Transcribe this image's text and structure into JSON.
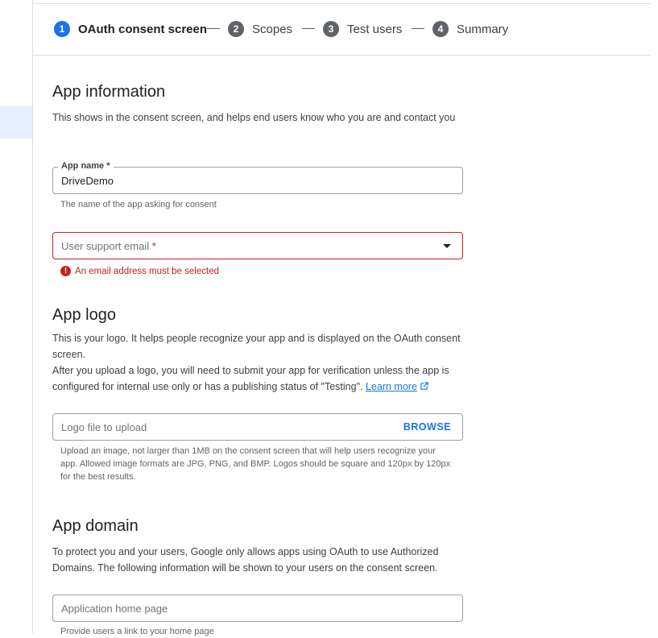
{
  "stepper": {
    "steps": [
      {
        "num": "1",
        "label": "OAuth consent screen"
      },
      {
        "num": "2",
        "label": "Scopes"
      },
      {
        "num": "3",
        "label": "Test users"
      },
      {
        "num": "4",
        "label": "Summary"
      }
    ]
  },
  "app_information": {
    "title": "App information",
    "description": "This shows in the consent screen, and helps end users know who you are and contact you",
    "app_name": {
      "label": "App name *",
      "value": "DriveDemo",
      "hint": "The name of the app asking for consent"
    },
    "support_email": {
      "placeholder": "User support email",
      "required_mark": "*",
      "error": "An email address must be selected"
    }
  },
  "app_logo": {
    "title": "App logo",
    "description_1": "This is your logo. It helps people recognize your app and is displayed on the OAuth consent screen.",
    "description_2": "After you upload a logo, you will need to submit your app for verification unless the app is configured for internal use only or has a publishing status of \"Testing\".",
    "learn_more": "Learn more",
    "upload": {
      "placeholder": "Logo file to upload",
      "browse_label": "BROWSE",
      "hint": "Upload an image, not larger than 1MB on the consent screen that will help users recognize your app. Allowed image formats are JPG, PNG, and BMP. Logos should be square and 120px by 120px for the best results."
    }
  },
  "app_domain": {
    "title": "App domain",
    "description": "To protect you and your users, Google only allows apps using OAuth to use Authorized Domains. The following information will be shown to your users on the consent screen.",
    "home_page": {
      "placeholder": "Application home page",
      "hint": "Provide users a link to your home page"
    }
  },
  "colors": {
    "accent": "#1a73e8",
    "error": "#c5221f",
    "step_inactive": "#5f6368"
  }
}
